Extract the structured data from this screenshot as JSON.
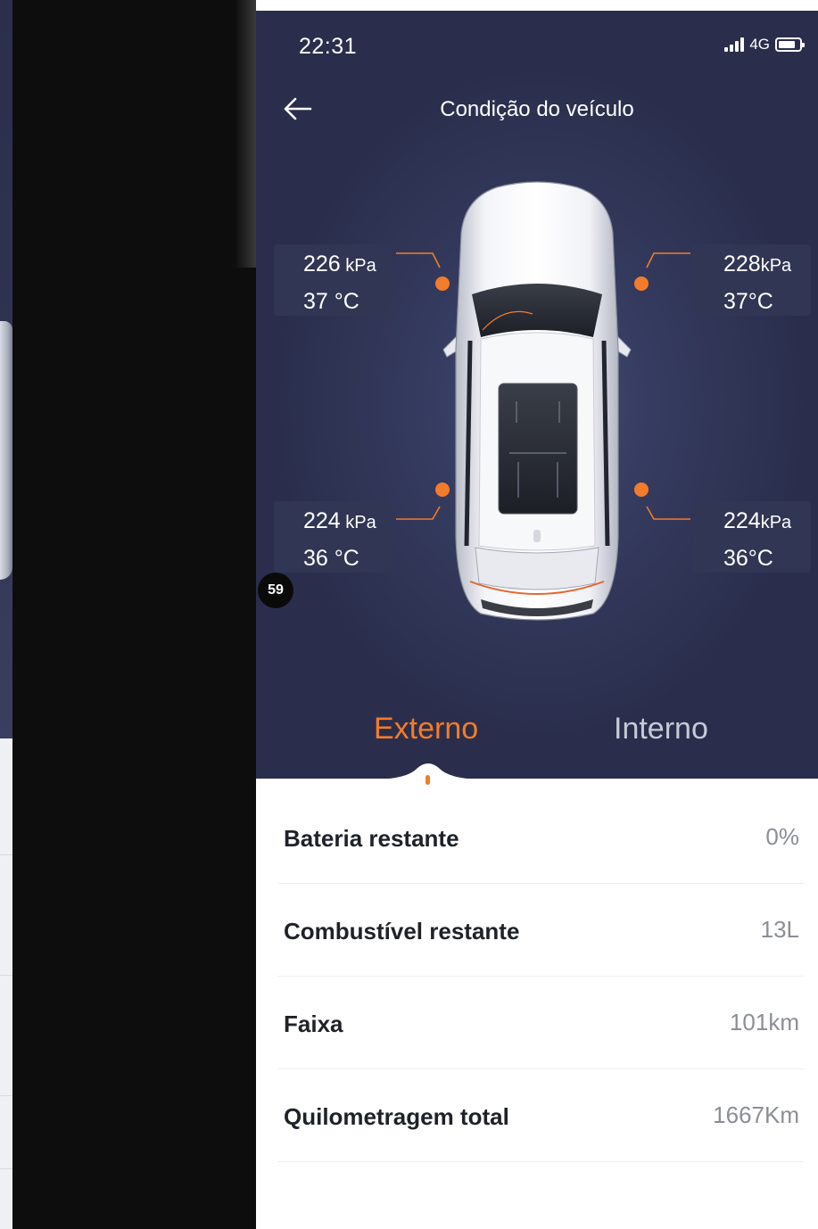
{
  "status_bar": {
    "time": "22:31",
    "network": "4G"
  },
  "header": {
    "title": "Condição do veículo"
  },
  "tires": {
    "front_left": {
      "pressure": "226",
      "pressure_unit": " kPa",
      "temp": "37 °C"
    },
    "front_right": {
      "pressure": "228",
      "pressure_unit": "kPa",
      "temp": "37°C"
    },
    "rear_left": {
      "pressure": "224",
      "pressure_unit": " kPa",
      "temp": "36 °C"
    },
    "rear_right": {
      "pressure": "224",
      "pressure_unit": "kPa",
      "temp": "36°C"
    }
  },
  "badge": {
    "value": "59"
  },
  "tabs": [
    {
      "label": "Externo",
      "active": true
    },
    {
      "label": "Interno",
      "active": false
    }
  ],
  "stats": [
    {
      "label": "Bateria restante",
      "value": "0%"
    },
    {
      "label": "Combustível restante",
      "value": "13L"
    },
    {
      "label": "Faixa",
      "value": "101km"
    },
    {
      "label": "Quilometragem total",
      "value": "1667Km"
    }
  ],
  "colors": {
    "accent": "#f37c2a",
    "hero_bg": "#2e3352",
    "tire_box": "#313754"
  },
  "icons": {
    "back": "arrow-left-icon",
    "signal": "signal-icon",
    "battery": "battery-icon"
  }
}
